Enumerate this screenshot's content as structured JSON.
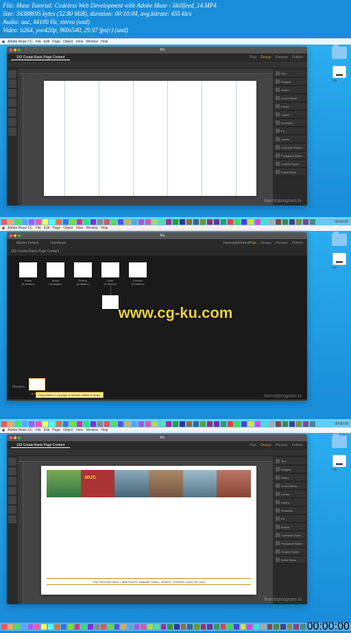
{
  "file_info": {
    "line1": "File: Muse Tutorial: Codeless Web Development with Adobe Muse - Skillfeed_14.MP4",
    "line2": "Size: 34388695 bytes (32.80 MiB), duration: 00:10:04, avg.bitrate: 455 kb/s",
    "line3": "Audio: aac, 44100 Hz, stereo (und)",
    "line4": "Video: h264, yuv420p, 960x540, 29.97 fps(r) (und)"
  },
  "menubar": {
    "app": "Adobe Muse CC",
    "items": [
      "File",
      "Edit",
      "Page",
      "Object",
      "View",
      "Window",
      "Help"
    ]
  },
  "desktop": {
    "drive_label": "ctv"
  },
  "app": {
    "title": "Mu",
    "tabs": {
      "page_tab": "152 Create Basic Page Content",
      "plan_tab_left": "Master Default",
      "plan_tab_right": "Thumbnail"
    },
    "modes": {
      "plan": "Plan",
      "design": "Design",
      "preview": "Preview",
      "publish": "Publish"
    },
    "plan_labels": {
      "horizontal": "Horizontal",
      "vertical": "Vertical"
    },
    "sitemap": [
      "Home",
      "About",
      "Photos",
      "More",
      "Contact"
    ],
    "sitemap_sub": "(A-Master)",
    "masters": "Masters",
    "master_name": "A-Master",
    "tooltip": "Drag master on to page or another master to apply.",
    "footer_text": "THE FROSTED MUG • 1856 SOUTH TAMIAMI TRAIL • VENICE, FLORIDA • (941) 497-1611",
    "mug_text": "MUG",
    "panels": [
      "Text",
      "Widgets",
      "States",
      "Scroll Effects",
      "Library",
      "Layers",
      "Swatches",
      "Fill",
      "Assets",
      "Character Styles",
      "Paragraph Styles",
      "Graphic Styles",
      "Bullet Styles"
    ]
  },
  "watermark": "learntoprogram.tv",
  "overlay": "www.cg-ku.com",
  "time": "00:00:00",
  "dock_colors": [
    "#f55",
    "#fa5",
    "#5d5",
    "#5af",
    "#a5f",
    "#f5a",
    "#ff5",
    "#5ff",
    "#d73",
    "#37d",
    "#7d3",
    "#d37",
    "#3d7",
    "#73d",
    "#888",
    "#d55",
    "#5d5",
    "#55d",
    "#da5",
    "#5ad",
    "#a5d",
    "#d5a",
    "#ad5",
    "#5da",
    "#939",
    "#393",
    "#339",
    "#963",
    "#369",
    "#693",
    "#936",
    "#639",
    "#396",
    "#d44",
    "#4d4",
    "#44d",
    "#dd4",
    "#d4d",
    "#4dd",
    "#aaa",
    "#844",
    "#484",
    "#448",
    "#884",
    "#848",
    "#488"
  ]
}
